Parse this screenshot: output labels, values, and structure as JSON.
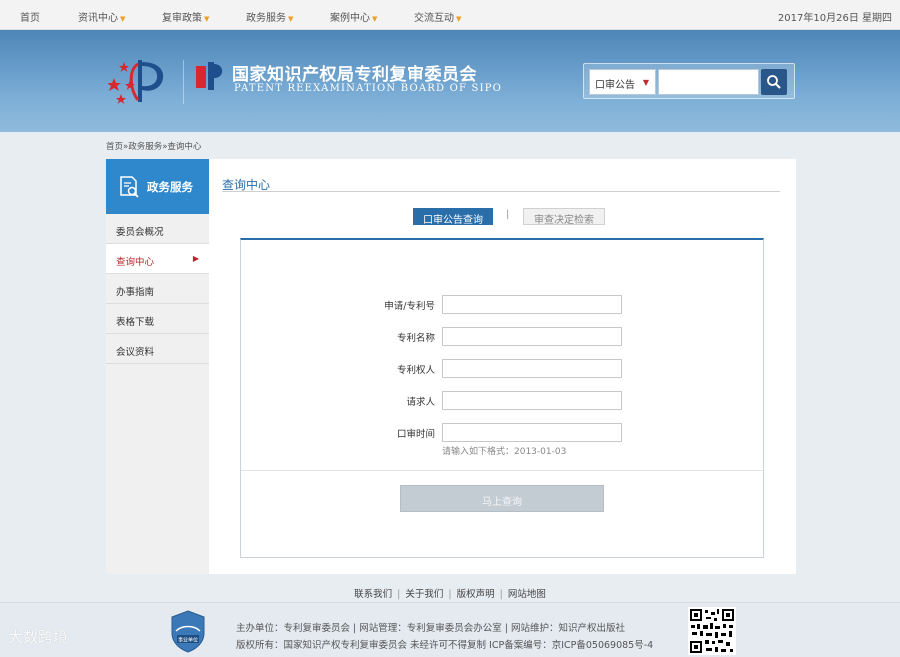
{
  "topnav": {
    "items": [
      {
        "label": "首页",
        "dropdown": false
      },
      {
        "label": "资讯中心",
        "dropdown": true
      },
      {
        "label": "复审政策",
        "dropdown": true
      },
      {
        "label": "政务服务",
        "dropdown": true
      },
      {
        "label": "案例中心",
        "dropdown": true
      },
      {
        "label": "交流互动",
        "dropdown": true
      }
    ],
    "date": "2017年10月26日 星期四"
  },
  "header": {
    "title_cn": "国家知识产权局专利复审委员会",
    "title_en": "PATENT REEXAMINATION BOARD OF SIPO",
    "search": {
      "select_value": "口审公告",
      "input_value": "",
      "icon": "search-icon"
    }
  },
  "breadcrumb": "首页»政务服务»查询中心",
  "sidebar": {
    "title": "政务服务",
    "items": [
      {
        "label": "委员会概况",
        "active": false
      },
      {
        "label": "查询中心",
        "active": true
      },
      {
        "label": "办事指南",
        "active": false
      },
      {
        "label": "表格下载",
        "active": false
      },
      {
        "label": "会议资料",
        "active": false
      }
    ]
  },
  "main": {
    "title": "查询中心",
    "tabs": [
      {
        "label": "口审公告查询",
        "active": true
      },
      {
        "label": "审查决定检索",
        "active": false
      }
    ],
    "tab_separator": "|",
    "form": {
      "fields": [
        {
          "label": "申请/专利号",
          "value": ""
        },
        {
          "label": "专利名称",
          "value": ""
        },
        {
          "label": "专利权人",
          "value": ""
        },
        {
          "label": "请求人",
          "value": ""
        },
        {
          "label": "口审时间",
          "value": ""
        }
      ],
      "date_hint": "请输入如下格式：2013-01-03",
      "submit_label": "马上查询"
    }
  },
  "footer": {
    "links": [
      "联系我们",
      "关于我们",
      "版权声明",
      "网站地图"
    ],
    "line1": "主办单位：专利复审委员会 | 网站管理：专利复审委员会办公室 | 网站维护：知识产权出版社",
    "line2": "版权所有：国家知识产权专利复审委员会 未经许可不得复制 ICP备案编号：京ICP备05069085号-4",
    "badge_text": "事业单位",
    "watermark": "大数跨境"
  },
  "colors": {
    "brand_blue": "#2a6ea9",
    "sidebar_blue": "#2f88cb",
    "active_red": "#b8262b",
    "header_blue": "#4d86b8"
  }
}
